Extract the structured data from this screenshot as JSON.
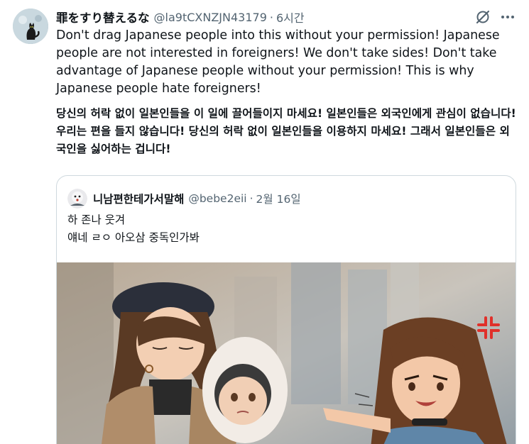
{
  "tweet": {
    "display_name": "罪をすり替えるな",
    "handle": "@la9tCXNZJN43179",
    "separator": "·",
    "time": "6시간",
    "text_en": "Don't drag Japanese people into this without your permission! Japanese people are not interested in foreigners! We don't take sides! Don't take advantage of Japanese people without your permission! This is why Japanese people hate foreigners!",
    "text_ko": "당신의 허락 없이 일본인들을 이 일에 끌어들이지 마세요! 일본인들은 외국인에게 관심이 없습니다! 우리는 편을 들지 않습니다! 당신의 허락 없이 일본인들을 이용하지 마세요! 그래서 일본인들은 외국인을 싫어하는 겁니다!",
    "icons": {
      "grok": "grok-icon",
      "more": "more-icon"
    }
  },
  "quote": {
    "display_name": "니남편한테가서말해",
    "handle": "@bebe2eii",
    "separator": "·",
    "date": "2월 16일",
    "line1": "하 존나 웃겨",
    "line2": "얘네 ㄹㅇ 아오삼 중독인가봐"
  },
  "colors": {
    "text": "#0f1419",
    "muted": "#536471",
    "border": "#cfd9de"
  }
}
